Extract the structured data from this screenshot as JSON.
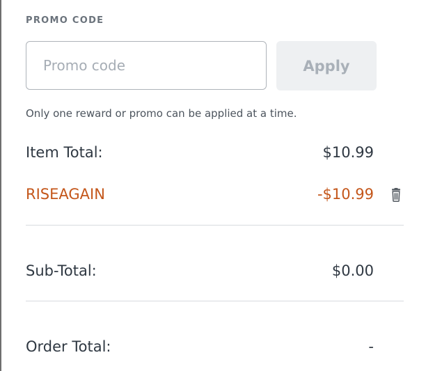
{
  "promo": {
    "section_title": "PROMO CODE",
    "input_placeholder": "Promo code",
    "input_value": "",
    "apply_label": "Apply",
    "note": "Only one reward or promo can be applied at a time."
  },
  "summary": {
    "item_total_label": "Item Total:",
    "item_total_value": "$10.99",
    "promo_code_label": "RISEAGAIN",
    "promo_discount_value": "-$10.99",
    "remove_icon": "trash-icon",
    "subtotal_label": "Sub-Total:",
    "subtotal_value": "$0.00",
    "order_total_label": "Order Total:",
    "order_total_value": "-"
  },
  "colors": {
    "promo_accent": "#c4561a",
    "apply_disabled_bg": "#eef0f2",
    "apply_disabled_text": "#a9b0b8",
    "text": "#2f3842"
  }
}
